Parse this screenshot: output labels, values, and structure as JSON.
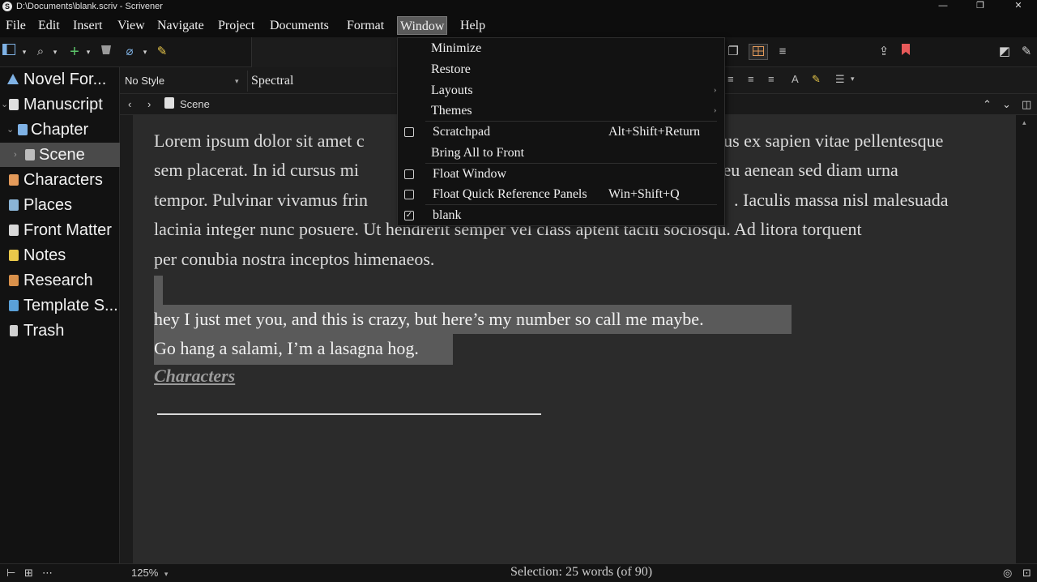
{
  "window": {
    "title": "D:\\Documents\\blank.scriv - Scrivener",
    "app_icon_letter": "S",
    "minimize": "—",
    "restore": "❐",
    "close": "✕"
  },
  "menubar": {
    "items": [
      "File",
      "Edit",
      "Insert",
      "View",
      "Navigate",
      "Project",
      "Documents",
      "Format",
      "Window",
      "Help"
    ],
    "active": "Window"
  },
  "window_menu": {
    "items": [
      {
        "label": "Minimize",
        "shortcut": "",
        "check": "none"
      },
      {
        "label": "Restore",
        "shortcut": "",
        "check": "none"
      },
      {
        "label": "Layouts",
        "shortcut": "",
        "check": "none",
        "submenu": true
      },
      {
        "label": "Themes",
        "shortcut": "",
        "check": "none",
        "submenu": true
      },
      {
        "label": "Scratchpad",
        "shortcut": "Alt+Shift+Return",
        "check": "unchecked"
      },
      {
        "label": "Bring All to Front",
        "shortcut": "",
        "check": "none"
      },
      {
        "label": "Float Window",
        "shortcut": "",
        "check": "unchecked"
      },
      {
        "label": "Float Quick Reference Panels",
        "shortcut": "Win+Shift+Q",
        "check": "unchecked"
      },
      {
        "label": "blank",
        "shortcut": "",
        "check": "checked"
      }
    ]
  },
  "binder": {
    "items": [
      {
        "label": "Novel For...",
        "icon": "triangle-icon",
        "color": "#7fb2e5"
      },
      {
        "label": "Manuscript",
        "icon": "document-icon",
        "color": "#e0e0e0"
      },
      {
        "label": "Chapter",
        "icon": "document-icon",
        "color": "#7fb2e5"
      },
      {
        "label": "Scene",
        "icon": "document-icon",
        "color": "#bdbdbd"
      },
      {
        "label": "Characters",
        "icon": "characters-icon",
        "color": "#e39a5a"
      },
      {
        "label": "Places",
        "icon": "places-icon",
        "color": "#8ab4d6"
      },
      {
        "label": "Front Matter",
        "icon": "front-matter-icon",
        "color": "#d8d8d8"
      },
      {
        "label": "Notes",
        "icon": "notes-icon",
        "color": "#e9c84a"
      },
      {
        "label": "Research",
        "icon": "research-icon",
        "color": "#d9914b"
      },
      {
        "label": "Template S...",
        "icon": "template-icon",
        "color": "#5aa0d8"
      },
      {
        "label": "Trash",
        "icon": "trash-icon",
        "color": "#d0d0d0"
      }
    ],
    "selected": "Scene"
  },
  "formatbar": {
    "paragraph_style": "No Style",
    "font": "Spectral"
  },
  "header": {
    "document_title": "Scene"
  },
  "editor": {
    "paragraph1_lines": [
      "Lorem ipsum dolor sit amet c",
      "sem placerat. In id cursus mi",
      "tempor. Pulvinar vivamus frin",
      "lacinia integer nunc posuere. Ut hendrerit semper vel class aptent taciti sociosqu. Ad litora torquent",
      "per conubia nostra inceptos himenaeos."
    ],
    "paragraph1_right": [
      "ibus ex sapien vitae pellentesque",
      "o eu aenean sed diam urna",
      ". Iaculis massa nisl malesuada"
    ],
    "selected_line1": "hey I just met you, and this is crazy, but here’s my number so call me maybe.",
    "selected_line2": "Go hang a salami, I’m a lasagna hog.",
    "link_text": "Characters"
  },
  "footer": {
    "zoom": "125%",
    "selection_status": "Selection: 25 words (of 90)"
  },
  "colors": {
    "selection": "#5a5a5a",
    "editor_bg": "#2b2b2b",
    "accent_green": "#5cc46a",
    "bookmark_red": "#e85a5a",
    "layout_orange": "#e39a5a"
  }
}
